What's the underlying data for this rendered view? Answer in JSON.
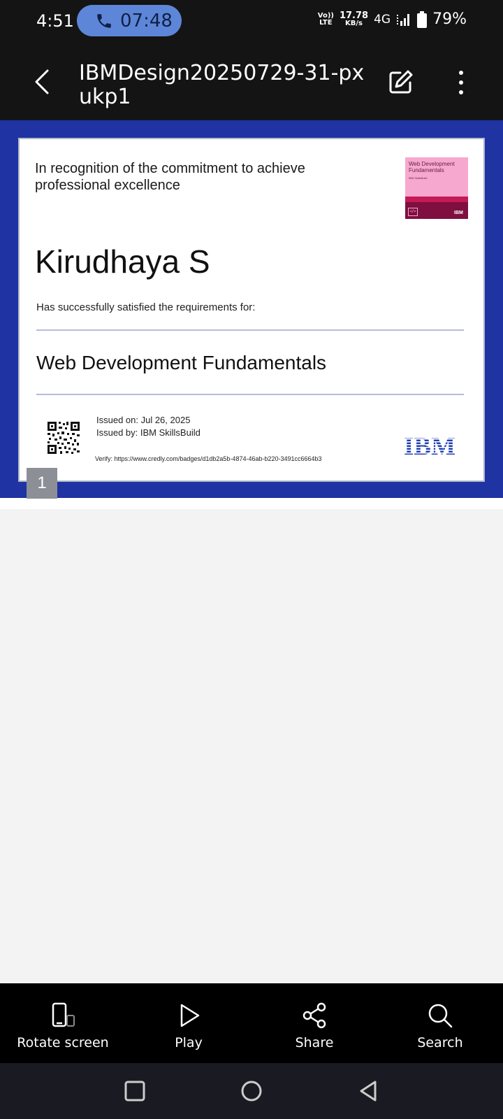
{
  "status_bar": {
    "time": "4:51",
    "call_timer": "07:48",
    "volte_line1": "Vo))",
    "volte_line2": "LTE",
    "speed_value": "17.78",
    "speed_unit": "KB/s",
    "network": "4G",
    "battery": "79%"
  },
  "app_bar": {
    "title": "IBMDesign20250729-31-pxukp1"
  },
  "certificate": {
    "intro": "In recognition of the commitment to achieve professional excellence",
    "recipient": "Kirudhaya S",
    "satisfied_text": "Has successfully satisfied the requirements for:",
    "course": "Web Development Fundamentals",
    "issued_on": "Issued on: Jul 26, 2025",
    "issued_by": "Issued by:  IBM SkillsBuild",
    "verify": "Verify:   https://www.credly.com/badges/d1db2a5b-4874-46ab-b220-3491cc6664b3",
    "badge_title": "Web Development Fundamentals",
    "badge_sub": "IBM SkillsBuild",
    "badge_brand": "IBM",
    "logo": "IBM"
  },
  "viewer": {
    "page_number": "1"
  },
  "bottom_bar": {
    "items": [
      {
        "label": "Rotate screen",
        "icon": "rotate-screen-icon"
      },
      {
        "label": "Play",
        "icon": "play-icon"
      },
      {
        "label": "Share",
        "icon": "share-icon"
      },
      {
        "label": "Search",
        "icon": "search-icon"
      }
    ]
  },
  "colors": {
    "viewer_background": "#1f33a3",
    "call_pill": "#5d86d9",
    "badge_pink": "#f7a8cf",
    "ibm_blue": "#1f3fb0"
  }
}
